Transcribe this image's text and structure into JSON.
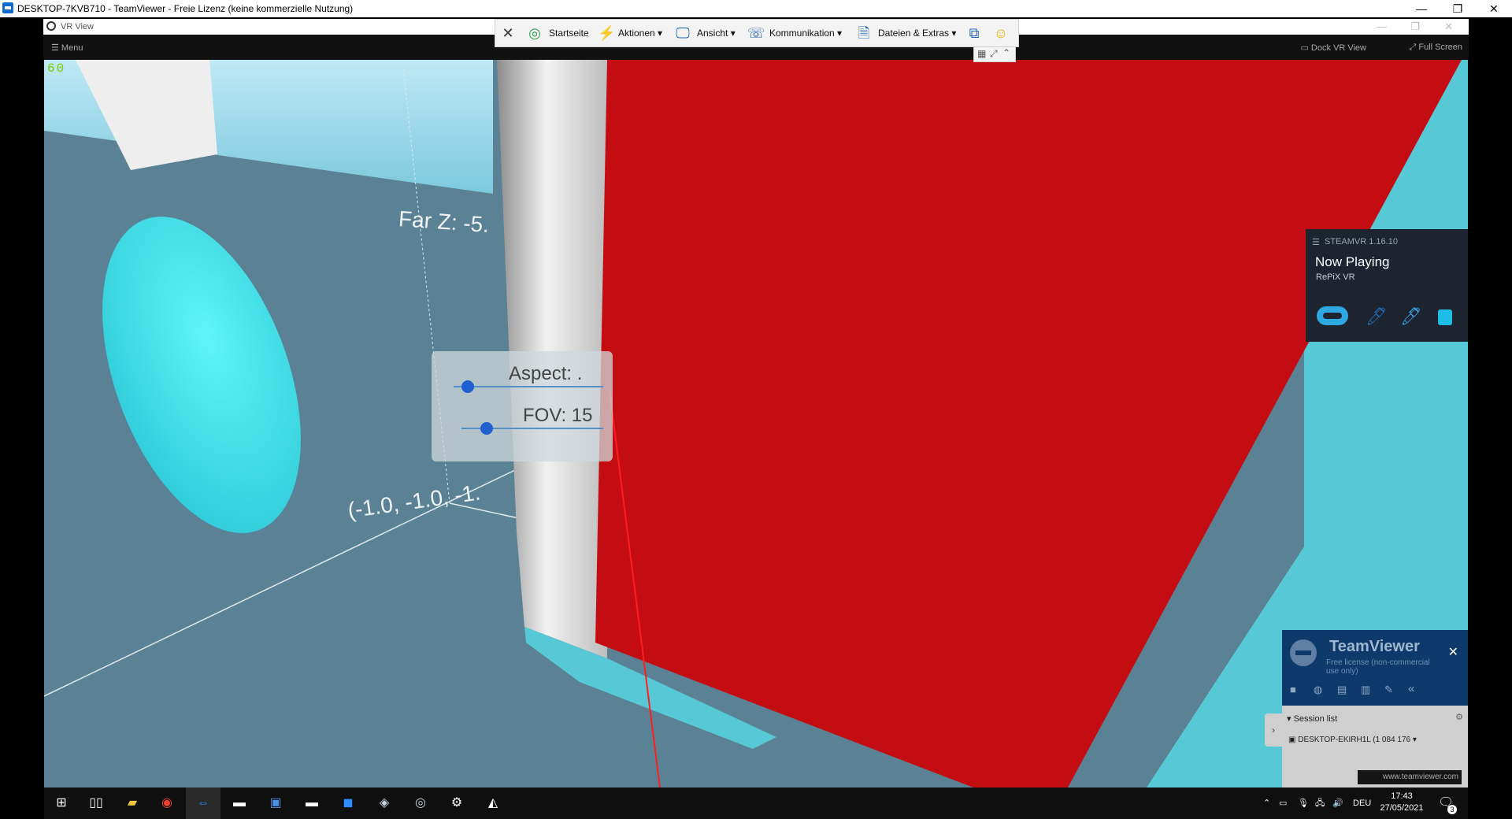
{
  "outer_window": {
    "title": "DESKTOP-7KVB710 - TeamViewer - Freie Lizenz (keine kommerzielle Nutzung)",
    "minimize": "—",
    "restore": "❐",
    "close": "✕"
  },
  "vr_window": {
    "title": "VR View",
    "menu_label": "Menu",
    "dock_label": "Dock VR View",
    "fullscreen_label": "Full Screen"
  },
  "toolbar": {
    "items": [
      {
        "label": "Startseite"
      },
      {
        "label": "Aktionen"
      },
      {
        "label": "Ansicht"
      },
      {
        "label": "Kommunikation"
      },
      {
        "label": "Dateien & Extras"
      }
    ]
  },
  "scene": {
    "fps": "60",
    "far_z_label": "Far Z: -5.",
    "aspect_label": "Aspect: .",
    "fov_label": "FOV: 15",
    "coord_label": "(-1.0, -1.0, -1."
  },
  "steamvr": {
    "header": "STEAMVR 1.16.10",
    "now_playing": "Now Playing",
    "app": "RePiX VR"
  },
  "tv_panel": {
    "brand": "TeamViewer",
    "license": "Free license (non-commercial use only)",
    "session_list": "Session list",
    "session_item": "DESKTOP-EKIRH1L (1 084 176",
    "link": "www.teamviewer.com"
  },
  "taskbar": {
    "lang": "DEU",
    "time": "17:43",
    "date": "27/05/2021",
    "notif_count": "3"
  },
  "colors": {
    "red_plane": "#c40d12",
    "floor": "#5b8294",
    "cyan": "#57c9d6",
    "tv_blue": "#0d3a6b"
  }
}
